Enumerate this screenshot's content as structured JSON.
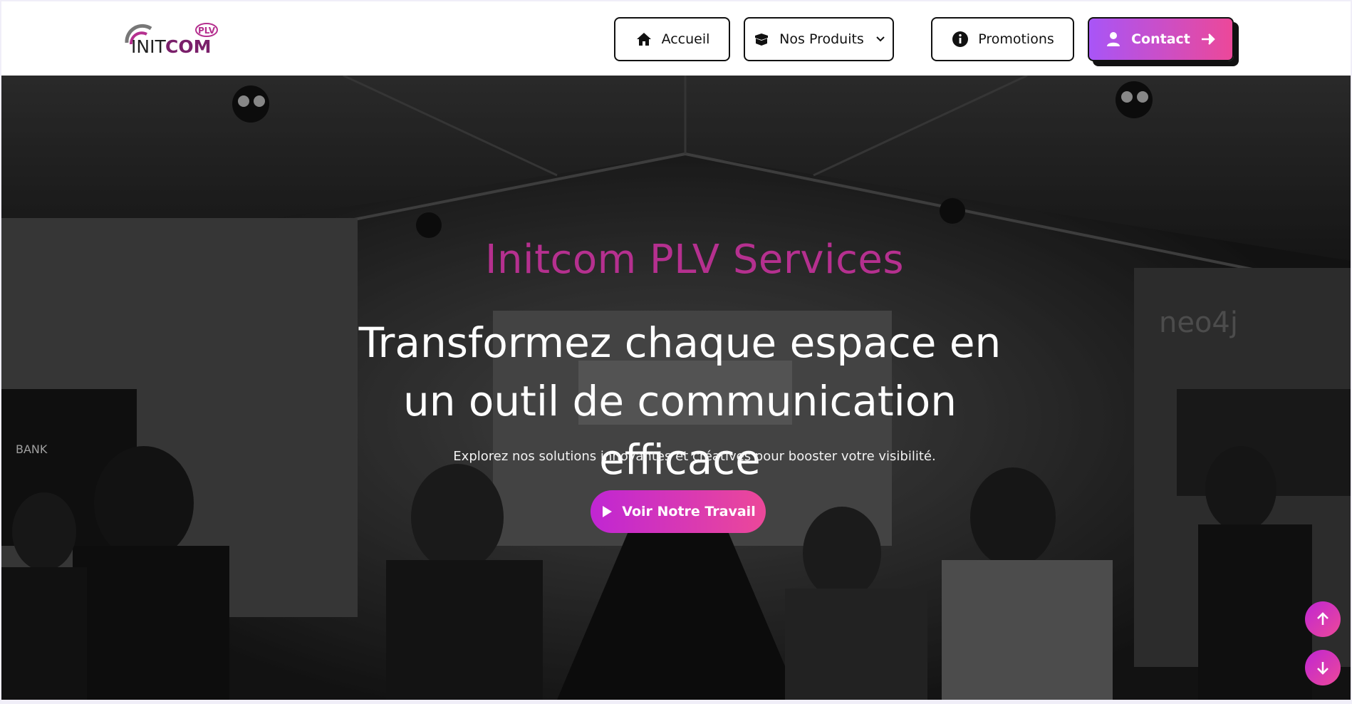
{
  "logo": {
    "text_main": "INITCOM",
    "text_badge": "PLV",
    "alt_label": "INITCOM PLV logo"
  },
  "nav": {
    "home": {
      "label": "Accueil",
      "icon": "house-icon"
    },
    "products": {
      "label": "Nos Produits",
      "icon": "box-icon",
      "dropdown_icon": "chevron-down-icon"
    },
    "promotions": {
      "label": "Promotions",
      "icon": "info-circle-icon"
    },
    "contact": {
      "label": "Contact",
      "icon": "user-icon",
      "trailing_icon": "arrow-right-icon"
    }
  },
  "hero": {
    "brand_title": "Initcom PLV Services",
    "headline": "Transformez chaque espace en un outil de communication efficace",
    "subtext": "Explorez nos solutions innovantes et créatives pour booster votre visibilité.",
    "cta_label": "Voir Notre Travail",
    "cta_icon": "play-icon"
  },
  "scroll": {
    "up_icon": "arrow-up-icon",
    "down_icon": "arrow-down-icon"
  },
  "colors": {
    "accent_purple": "#a855f7",
    "accent_pink": "#ec4899",
    "brand_magenta": "#b5308f",
    "border_dark": "#111111"
  }
}
